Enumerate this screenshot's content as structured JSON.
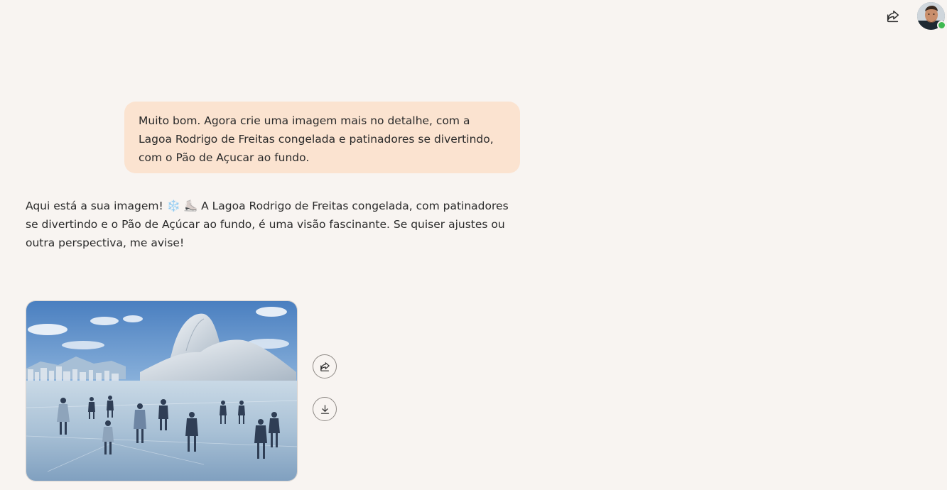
{
  "header": {
    "share_icon": "share-icon",
    "avatar_icon": "user-avatar"
  },
  "conversation": {
    "user_message": "Muito bom. Agora crie uma imagem mais no detalhe, com a Lagoa Rodrigo de Freitas congelada e patinadores se divertindo, com o Pão de Açucar ao fundo.",
    "assistant_message": {
      "before_emoji": "Aqui está a sua imagem!",
      "emoji_1": "❄️",
      "emoji_2": "⛸️",
      "after_emoji": "A Lagoa Rodrigo de Freitas congelada, com patinadores se divertindo e o Pão de Açúcar ao fundo, é uma visão fascinante. Se quiser ajustes ou outra perspectiva, me avise!"
    },
    "image_actions": {
      "share_icon": "share-icon",
      "download_icon": "download-icon"
    }
  },
  "colors": {
    "background": "#f8f4f1",
    "user_bubble": "#fbe3d0",
    "text": "#2a2a2a"
  }
}
